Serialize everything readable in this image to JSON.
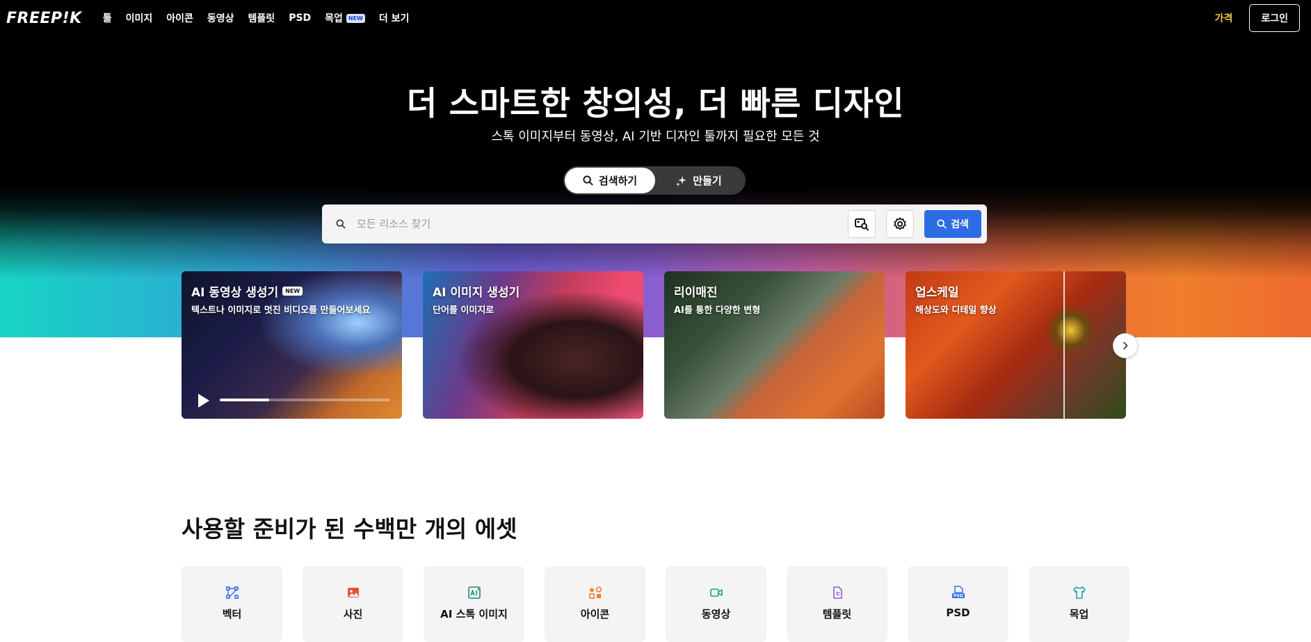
{
  "nav": {
    "logo": "FREEP!K",
    "items": [
      {
        "label": "툴"
      },
      {
        "label": "이미지"
      },
      {
        "label": "아이콘"
      },
      {
        "label": "동영상"
      },
      {
        "label": "템플릿"
      },
      {
        "label": "PSD"
      },
      {
        "label": "목업",
        "badge": "NEW"
      },
      {
        "label": "더 보기"
      }
    ],
    "price": "가격",
    "login": "로그인"
  },
  "hero": {
    "title": "더 스마트한 창의성, 더 빠른 디자인",
    "subtitle": "스톡 이미지부터 동영상, AI 기반 디자인 툴까지 필요한 모든 것",
    "toggle": {
      "search": "검색하기",
      "create": "만들기",
      "active": "search"
    }
  },
  "search": {
    "placeholder": "모든 리소스 찾기",
    "button": "검색",
    "icons": [
      "search-icon",
      "image-search-icon",
      "settings-icon"
    ]
  },
  "cards": [
    {
      "title": "AI 동영상 생성기",
      "badge": "NEW",
      "desc": "텍스트나 이미지로 멋진 비디오를 만들어보세요",
      "progress": 0.29
    },
    {
      "title": "AI 이미지 생성기",
      "desc": "단어를 이미지로"
    },
    {
      "title": "리이매진",
      "desc": "AI를 통한 다양한 변형"
    },
    {
      "title": "업스케일",
      "desc": "해상도와 디테일 향상"
    }
  ],
  "assets": {
    "title": "사용할 준비가 된 수백만 개의 에셋",
    "items": [
      {
        "label": "벡터",
        "icon": "vector-icon",
        "color": "#2e6ce6"
      },
      {
        "label": "사진",
        "icon": "photo-icon",
        "color": "#e5533a"
      },
      {
        "label": "AI 스톡 이미지",
        "icon": "ai-image-icon",
        "color": "#1d8a7a"
      },
      {
        "label": "아이콘",
        "icon": "icons-icon",
        "color": "#f07e2c"
      },
      {
        "label": "동영상",
        "icon": "video-icon",
        "color": "#1aa37a"
      },
      {
        "label": "템플릿",
        "icon": "template-icon",
        "color": "#8b5fd0"
      },
      {
        "label": "PSD",
        "icon": "psd-icon",
        "color": "#2e6ce6"
      },
      {
        "label": "목업",
        "icon": "mockup-icon",
        "color": "#17a5a0"
      }
    ]
  }
}
